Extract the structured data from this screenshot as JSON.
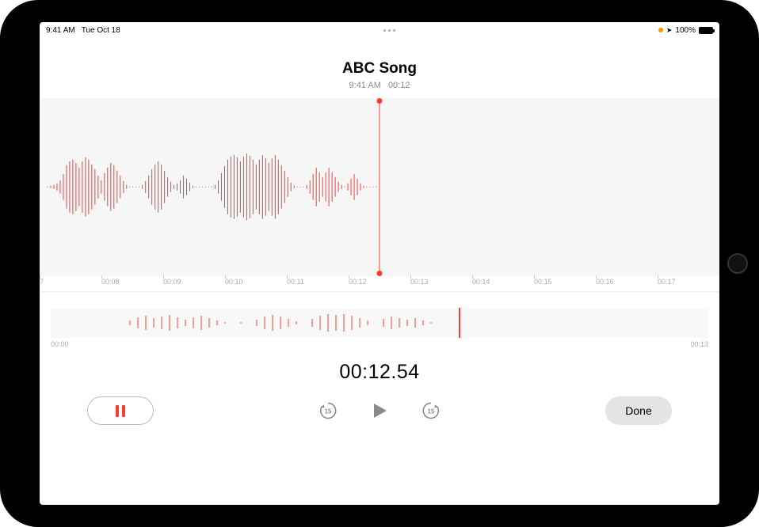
{
  "status": {
    "time": "9:41 AM",
    "date": "Tue Oct 18",
    "battery_pct": "100%"
  },
  "recording": {
    "title": "ABC Song",
    "meta_time": "9:41 AM",
    "meta_duration": "00:12"
  },
  "ruler_ticks": [
    "7",
    "00:08",
    "00:09",
    "00:10",
    "00:11",
    "00:12",
    "00:13",
    "00:14",
    "00:15",
    "00:16",
    "00:17"
  ],
  "overview": {
    "start": "00:00",
    "end": "00:13",
    "playhead_pct": 62
  },
  "counter": "00:12.54",
  "controls": {
    "skip_seconds": "15",
    "done_label": "Done"
  },
  "colors": {
    "accent": "#ff3b30"
  }
}
